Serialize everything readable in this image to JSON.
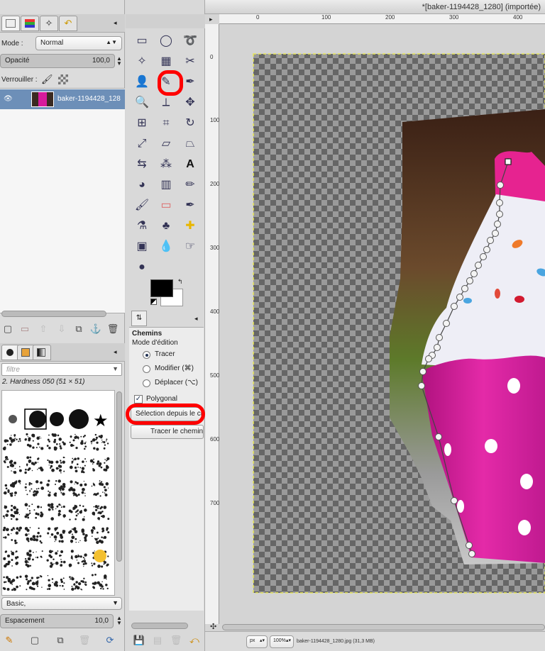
{
  "window_title": "*[baker-1194428_1280] (importée)",
  "layers_panel": {
    "mode_label": "Mode :",
    "mode_value": "Normal",
    "opacity_label": "Opacité",
    "opacity_value": "100,0",
    "lock_label": "Verrouiller :",
    "layer_name": "baker-1194428_128"
  },
  "brushes_panel": {
    "filter_placeholder": "filtre",
    "brush_name": "2. Hardness 050 (51 × 51)",
    "preset_value": "Basic,",
    "spacing_label": "Espacement",
    "spacing_value": "10,0"
  },
  "tool_options": {
    "title": "Chemins",
    "edit_mode_label": "Mode d'édition",
    "radio_draw": "Tracer",
    "radio_edit": "Modifier (⌘)",
    "radio_move": "Déplacer (⌥)",
    "polygonal_label": "Polygonal",
    "selection_from_path_button": "Sélection depuis le ch",
    "stroke_path_button": "Tracer le chemin"
  },
  "rulers": {
    "h_ticks": [
      "0",
      "100",
      "200",
      "300",
      "400"
    ],
    "v_ticks": [
      "0",
      "100",
      "200",
      "300",
      "400",
      "500",
      "600",
      "700"
    ]
  },
  "status_bar": {
    "unit": "px",
    "zoom": "100%",
    "file_info": "baker-1194428_1280.jpg (31,3 MB)"
  },
  "colors": {
    "accent": "#6d8fb8",
    "highlight": "#ff0000",
    "foreground": "#000000",
    "background": "#ffffff",
    "cupcake_pink": "#d61a9c"
  }
}
